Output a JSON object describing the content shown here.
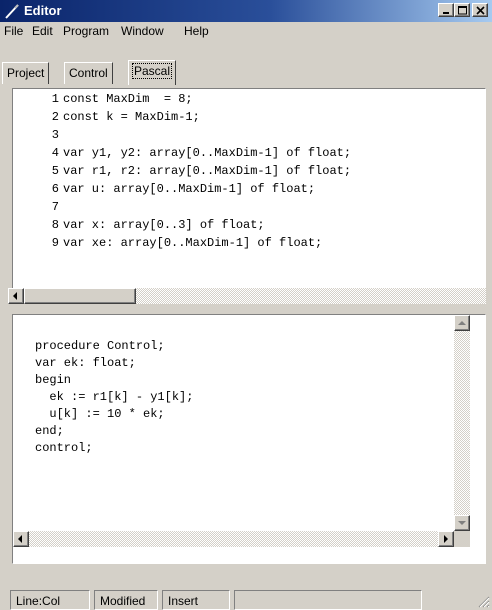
{
  "window": {
    "title": "Editor",
    "icon": "pencil-icon",
    "controls": [
      "minimize-icon",
      "maximize-icon",
      "close-icon"
    ]
  },
  "menu": {
    "items": [
      "File",
      "Edit",
      "Program",
      "Window",
      "Help"
    ]
  },
  "tabs": {
    "items": [
      "Project",
      "Control",
      "Pascal"
    ],
    "active": "Pascal"
  },
  "editor_top": {
    "lines": [
      {
        "num": "1",
        "text": "const MaxDim  = 8;"
      },
      {
        "num": "2",
        "text": "const k = MaxDim-1;"
      },
      {
        "num": "3",
        "text": ""
      },
      {
        "num": "4",
        "text": "var y1, y2: array[0..MaxDim-1] of float;"
      },
      {
        "num": "5",
        "text": "var r1, r2: array[0..MaxDim-1] of float;"
      },
      {
        "num": "6",
        "text": "var u: array[0..MaxDim-1] of float;"
      },
      {
        "num": "7",
        "text": ""
      },
      {
        "num": "8",
        "text": "var x: array[0..3] of float;"
      },
      {
        "num": "9",
        "text": "var xe: array[0..MaxDim-1] of float;"
      }
    ]
  },
  "editor_bottom": {
    "lines": [
      "procedure Control;",
      "var ek: float;",
      "begin",
      "  ek := r1[k] - y1[k];",
      "  u[k] := 10 * ek;",
      "end;",
      "control;"
    ]
  },
  "statusbar": {
    "cells": [
      "Line:Col",
      "Modified",
      "Insert",
      ""
    ]
  },
  "colors": {
    "titlebar_start": "#0a246a",
    "titlebar_end": "#a6caf0",
    "face": "#d4d0c8"
  }
}
